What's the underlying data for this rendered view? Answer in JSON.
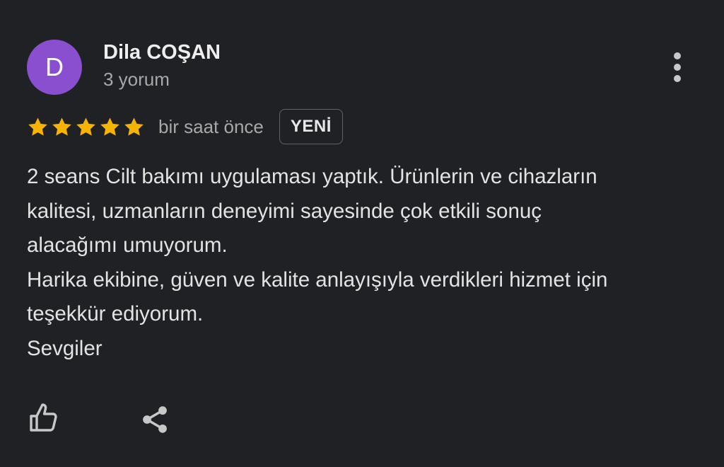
{
  "reviewer": {
    "avatar_initial": "D",
    "avatar_color": "#8a4fcf",
    "name": "Dila COŞAN",
    "review_count": "3 yorum"
  },
  "menu": {
    "icon": "more-vertical-icon"
  },
  "review": {
    "rating": 5,
    "max_rating": 5,
    "star_color": "#f6b400",
    "time_ago": "bir saat önce",
    "badge": "YENİ",
    "lines": [
      "2 seans Cilt bakımı uygulaması yaptık. Ürünlerin ve cihazların",
      "kalitesi, uzmanların deneyimi sayesinde çok etkili sonuç",
      "alacağımı umuyorum.",
      "Harika ekibine, güven ve kalite anlayışıyla verdikleri hizmet için",
      "teşekkür ediyorum.",
      "Sevgiler"
    ]
  },
  "actions": {
    "like_icon": "thumbs-up-icon",
    "share_icon": "share-icon"
  },
  "colors": {
    "background": "#202124",
    "text_primary": "#e3e3e3",
    "text_secondary": "#a8a8a8",
    "badge_border": "#5f6368",
    "icon": "#c8c8c8"
  }
}
